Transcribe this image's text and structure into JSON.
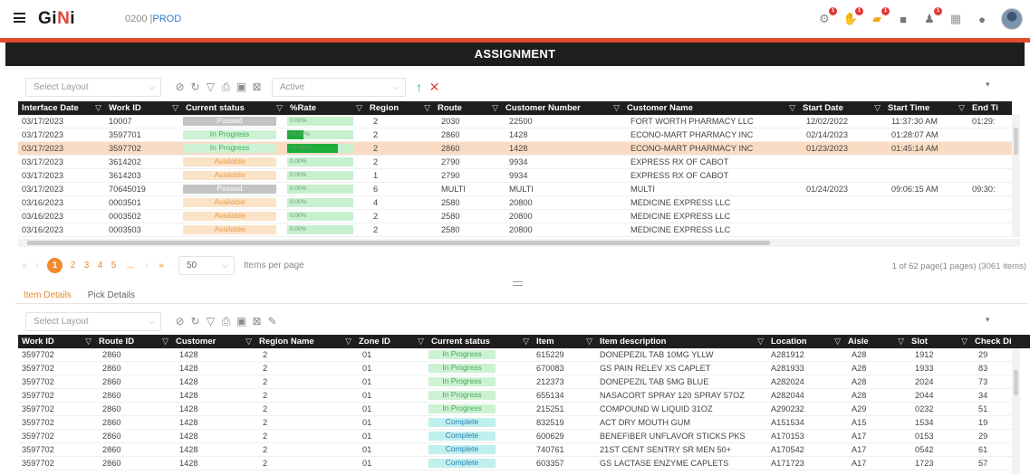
{
  "app": {
    "logo": "GiNi",
    "env_code": "0200 |",
    "env_name": "PROD",
    "page_title": "ASSIGNMENT"
  },
  "topbar_icons": [
    {
      "name": "workers-icon",
      "glyph": "⚙",
      "badge": "1"
    },
    {
      "name": "hand-alert-icon",
      "glyph": "✋",
      "badge": "1"
    },
    {
      "name": "folder-alert-icon",
      "glyph": "▰",
      "badge": "1"
    },
    {
      "name": "video-icon",
      "glyph": "■",
      "badge": ""
    },
    {
      "name": "bell-icon",
      "glyph": "♟",
      "badge": "1"
    },
    {
      "name": "report-icon",
      "glyph": "▦",
      "badge": ""
    },
    {
      "name": "help-icon",
      "glyph": "●",
      "badge": ""
    }
  ],
  "top_grid": {
    "toolbar": {
      "layout_placeholder": "Select Layout",
      "filter_value": "Active"
    },
    "columns": [
      {
        "key": "interface_date",
        "label": "Interface Date"
      },
      {
        "key": "work_id",
        "label": "Work ID"
      },
      {
        "key": "current_status",
        "label": "Current status"
      },
      {
        "key": "rate",
        "label": "%Rate"
      },
      {
        "key": "region",
        "label": "Region"
      },
      {
        "key": "route",
        "label": "Route"
      },
      {
        "key": "customer_number",
        "label": "Customer Number"
      },
      {
        "key": "customer_name",
        "label": "Customer Name"
      },
      {
        "key": "start_date",
        "label": "Start Date"
      },
      {
        "key": "start_time",
        "label": "Start Time"
      },
      {
        "key": "end_time",
        "label": "End Ti"
      }
    ],
    "rows": [
      {
        "interface_date": "03/17/2023",
        "work_id": "10007",
        "current_status": "Passed",
        "rate": "0.00%",
        "rate_pct": 0,
        "region": "2",
        "route": "2030",
        "customer_number": "22500",
        "customer_name": "FORT WORTH PHARMACY LLC",
        "start_date": "12/02/2022",
        "start_time": "11:37:30 AM",
        "end_time": "01:29:"
      },
      {
        "interface_date": "03/17/2023",
        "work_id": "3597701",
        "current_status": "In Progress",
        "rate": "24.07%",
        "rate_pct": 24.07,
        "region": "2",
        "route": "2860",
        "customer_number": "1428",
        "customer_name": "ECONO-MART PHARMACY INC",
        "start_date": "02/14/2023",
        "start_time": "01:28:07 AM",
        "end_time": ""
      },
      {
        "interface_date": "03/17/2023",
        "work_id": "3597702",
        "current_status": "In Progress",
        "rate": "76.43%",
        "rate_pct": 76.43,
        "region": "2",
        "route": "2860",
        "customer_number": "1428",
        "customer_name": "ECONO-MART PHARMACY INC",
        "start_date": "01/23/2023",
        "start_time": "01:45:14 AM",
        "end_time": "",
        "selected": true
      },
      {
        "interface_date": "03/17/2023",
        "work_id": "3614202",
        "current_status": "Available",
        "rate": "0.00%",
        "rate_pct": 0,
        "region": "2",
        "route": "2790",
        "customer_number": "9934",
        "customer_name": "EXPRESS RX OF CABOT",
        "start_date": "",
        "start_time": "",
        "end_time": ""
      },
      {
        "interface_date": "03/17/2023",
        "work_id": "3614203",
        "current_status": "Available",
        "rate": "0.00%",
        "rate_pct": 0,
        "region": "1",
        "route": "2790",
        "customer_number": "9934",
        "customer_name": "EXPRESS RX OF CABOT",
        "start_date": "",
        "start_time": "",
        "end_time": ""
      },
      {
        "interface_date": "03/17/2023",
        "work_id": "70645019",
        "current_status": "Passed",
        "rate": "0.00%",
        "rate_pct": 0,
        "region": "6",
        "route": "MULTI",
        "customer_number": "MULTI",
        "customer_name": "MULTI",
        "start_date": "01/24/2023",
        "start_time": "09:06:15 AM",
        "end_time": "09:30:"
      },
      {
        "interface_date": "03/16/2023",
        "work_id": "0003501",
        "current_status": "Available",
        "rate": "0.00%",
        "rate_pct": 0,
        "region": "4",
        "route": "2580",
        "customer_number": "20800",
        "customer_name": "MEDICINE EXPRESS LLC",
        "start_date": "",
        "start_time": "",
        "end_time": ""
      },
      {
        "interface_date": "03/16/2023",
        "work_id": "0003502",
        "current_status": "Available",
        "rate": "0.00%",
        "rate_pct": 0,
        "region": "2",
        "route": "2580",
        "customer_number": "20800",
        "customer_name": "MEDICINE EXPRESS LLC",
        "start_date": "",
        "start_time": "",
        "end_time": ""
      },
      {
        "interface_date": "03/16/2023",
        "work_id": "0003503",
        "current_status": "Available",
        "rate": "0.00%",
        "rate_pct": 0,
        "region": "2",
        "route": "2580",
        "customer_number": "20800",
        "customer_name": "MEDICINE EXPRESS LLC",
        "start_date": "",
        "start_time": "",
        "end_time": ""
      }
    ],
    "pager": {
      "first": "«",
      "prev": "‹",
      "pages": [
        "1",
        "2",
        "3",
        "4",
        "5",
        "..."
      ],
      "active_page": "1",
      "next": "›",
      "last": "»",
      "page_size": "50",
      "items_per_page_label": "Items per page",
      "summary": "1 of 62 page(1 pages) (3061 items)"
    }
  },
  "tabs": [
    {
      "label": "Item Details",
      "active": true
    },
    {
      "label": "Pick Details",
      "active": false
    }
  ],
  "bottom_grid": {
    "toolbar": {
      "layout_placeholder": "Select Layout"
    },
    "columns": [
      {
        "key": "work_id",
        "label": "Work ID"
      },
      {
        "key": "route_id",
        "label": "Route ID"
      },
      {
        "key": "customer",
        "label": "Customer"
      },
      {
        "key": "region_name",
        "label": "Region Name"
      },
      {
        "key": "zone_id",
        "label": "Zone ID"
      },
      {
        "key": "current_status",
        "label": "Current status"
      },
      {
        "key": "item",
        "label": "Item"
      },
      {
        "key": "item_description",
        "label": "Item description"
      },
      {
        "key": "location",
        "label": "Location"
      },
      {
        "key": "aisle",
        "label": "Aisle"
      },
      {
        "key": "slot",
        "label": "Slot"
      },
      {
        "key": "check_digit",
        "label": "Check Di"
      }
    ],
    "rows": [
      {
        "work_id": "3597702",
        "route_id": "2860",
        "customer": "1428",
        "region_name": "2",
        "zone_id": "01",
        "current_status": "In Progress",
        "item": "615229",
        "item_description": "DONEPEZIL TAB 10MG YLLW",
        "location": "A281912",
        "aisle": "A28",
        "slot": "1912",
        "check_digit": "29"
      },
      {
        "work_id": "3597702",
        "route_id": "2860",
        "customer": "1428",
        "region_name": "2",
        "zone_id": "01",
        "current_status": "In Progress",
        "item": "670083",
        "item_description": "GS PAIN RELEV XS CAPLET",
        "location": "A281933",
        "aisle": "A28",
        "slot": "1933",
        "check_digit": "83"
      },
      {
        "work_id": "3597702",
        "route_id": "2860",
        "customer": "1428",
        "region_name": "2",
        "zone_id": "01",
        "current_status": "In Progress",
        "item": "212373",
        "item_description": "DONEPEZIL TAB 5MG BLUE",
        "location": "A282024",
        "aisle": "A28",
        "slot": "2024",
        "check_digit": "73"
      },
      {
        "work_id": "3597702",
        "route_id": "2860",
        "customer": "1428",
        "region_name": "2",
        "zone_id": "01",
        "current_status": "In Progress",
        "item": "655134",
        "item_description": "NASACORT SPRAY 120 SPRAY 57OZ",
        "location": "A282044",
        "aisle": "A28",
        "slot": "2044",
        "check_digit": "34"
      },
      {
        "work_id": "3597702",
        "route_id": "2860",
        "customer": "1428",
        "region_name": "2",
        "zone_id": "01",
        "current_status": "In Progress",
        "item": "215251",
        "item_description": "COMPOUND W LIQUID 31OZ",
        "location": "A290232",
        "aisle": "A29",
        "slot": "0232",
        "check_digit": "51"
      },
      {
        "work_id": "3597702",
        "route_id": "2860",
        "customer": "1428",
        "region_name": "2",
        "zone_id": "01",
        "current_status": "Complete",
        "item": "832519",
        "item_description": "ACT DRY MOUTH GUM",
        "location": "A151534",
        "aisle": "A15",
        "slot": "1534",
        "check_digit": "19"
      },
      {
        "work_id": "3597702",
        "route_id": "2860",
        "customer": "1428",
        "region_name": "2",
        "zone_id": "01",
        "current_status": "Complete",
        "item": "600629",
        "item_description": "BENEFIBER UNFLAVOR STICKS PKS",
        "location": "A170153",
        "aisle": "A17",
        "slot": "0153",
        "check_digit": "29"
      },
      {
        "work_id": "3597702",
        "route_id": "2860",
        "customer": "1428",
        "region_name": "2",
        "zone_id": "01",
        "current_status": "Complete",
        "item": "740761",
        "item_description": "21ST CENT SENTRY SR MEN 50+",
        "location": "A170542",
        "aisle": "A17",
        "slot": "0542",
        "check_digit": "61"
      },
      {
        "work_id": "3597702",
        "route_id": "2860",
        "customer": "1428",
        "region_name": "2",
        "zone_id": "01",
        "current_status": "Complete",
        "item": "603357",
        "item_description": "GS LACTASE ENZYME CAPLETS",
        "location": "A171723",
        "aisle": "A17",
        "slot": "1723",
        "check_digit": "57"
      }
    ]
  },
  "colors": {
    "accent": "#e04b2e",
    "header_bg": "#1e1e1e",
    "selected_row": "#f9dcc3",
    "pager_active": "#f08a2a"
  }
}
